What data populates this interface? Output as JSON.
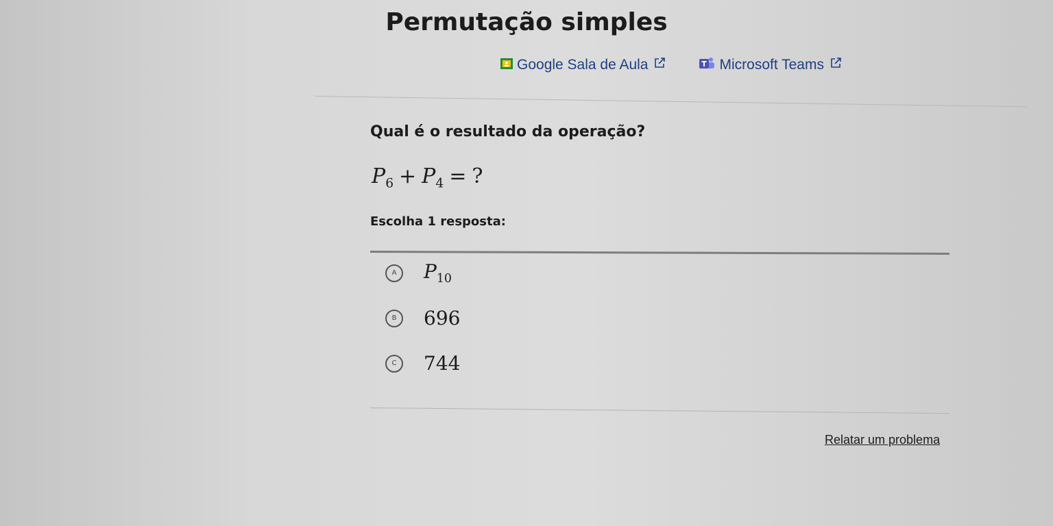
{
  "page": {
    "title": "Permutação simples"
  },
  "share": {
    "google_label": "Google Sala de Aula",
    "teams_label": "Microsoft Teams"
  },
  "question": {
    "prompt": "Qual é o resultado da operação?",
    "equation": {
      "term1": "P",
      "term1_sub": "6",
      "op1": "+",
      "term2": "P",
      "term2_sub": "4",
      "op2": "=",
      "result": "?"
    },
    "instruction": "Escolha 1 resposta:"
  },
  "choices": [
    {
      "letter": "A",
      "value": "P",
      "value_sub": "10"
    },
    {
      "letter": "B",
      "value": "696"
    },
    {
      "letter": "C",
      "value": "744"
    }
  ],
  "footer": {
    "report_label": "Relatar um problema"
  },
  "colors": {
    "link": "#1d3f86",
    "google_icon": "#1e8e3e",
    "teams_icon": "#4b53bc"
  }
}
